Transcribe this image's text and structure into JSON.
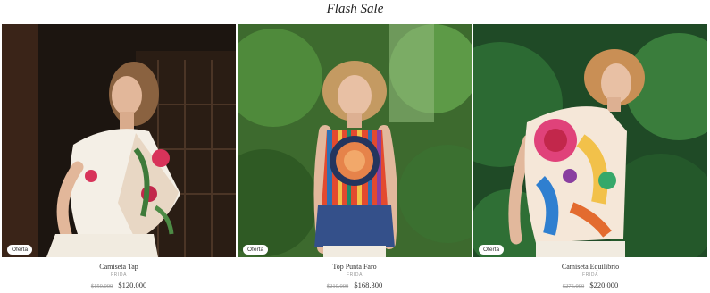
{
  "section": {
    "title": "Flash Sale"
  },
  "products": [
    {
      "name": "Camiseta Tap",
      "brand": "FRIDA",
      "old_price": "$150.000",
      "price": "$120.000",
      "badge": "Oferta"
    },
    {
      "name": "Top Punta Faro",
      "brand": "FRIDA",
      "old_price": "$210.000",
      "price": "$168.300",
      "badge": "Oferta"
    },
    {
      "name": "Camiseta Equilibrio",
      "brand": "FRIDA",
      "old_price": "$275.000",
      "price": "$220.000",
      "badge": "Oferta"
    }
  ]
}
